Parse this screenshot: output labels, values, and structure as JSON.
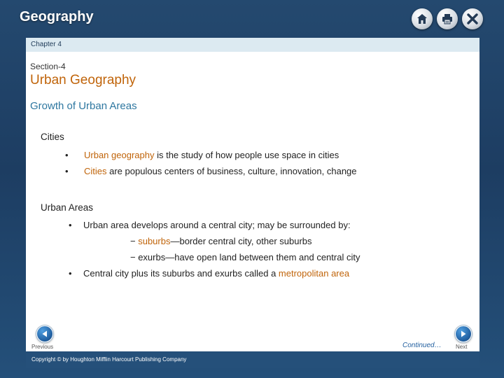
{
  "app": {
    "title": "Geography",
    "icons": [
      "home-icon",
      "print-icon",
      "close-icon"
    ]
  },
  "chapter": {
    "label": "Chapter 4"
  },
  "slide": {
    "section": "Section-4",
    "title": "Urban Geography",
    "subtitle": "Growth of Urban Areas",
    "cities": {
      "heading": "Cities",
      "bullets": [
        {
          "term": "Urban geography",
          "rest": " is the study of how people use space in cities"
        },
        {
          "term": "Cities",
          "rest": " are populous centers of business, culture, innovation, change"
        }
      ]
    },
    "urban_areas": {
      "heading": "Urban Areas",
      "bullet1": "Urban area develops around a central city; may be surrounded by:",
      "sub1_prefix": "− ",
      "sub1_term": "suburbs",
      "sub1_rest": "—border central city, other suburbs",
      "sub2": "− exurbs—have open land between them and central city",
      "bullet2_prefix": "Central city plus its suburbs and exurbs called a ",
      "bullet2_term": "metropolitan area"
    }
  },
  "nav": {
    "previous_label": "Previous",
    "next_label": "Next",
    "continued_label": "Continued…"
  },
  "footer": {
    "copyright": "Copyright © by Houghton Mifflin Harcourt Publishing Company"
  },
  "colors": {
    "frame": "#24496f",
    "term_orange": "#c0640a",
    "subtitle_blue": "#2e77a0",
    "chapter_bar": "#dceaf1",
    "footer_bar": "#25507a"
  }
}
